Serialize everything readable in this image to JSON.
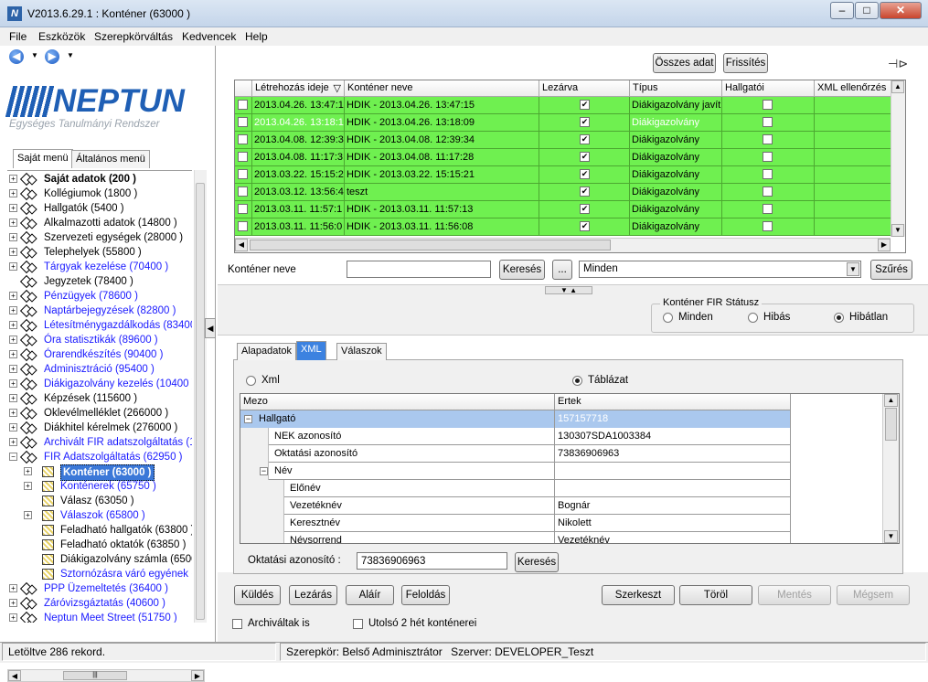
{
  "window": {
    "title": "V2013.6.29.1 : Konténer (63000  )",
    "icon": "N",
    "min": "‒",
    "max": "□",
    "close": "✕"
  },
  "menu": [
    "File",
    "Eszközök",
    "Szerepkörváltás",
    "Kedvencek",
    "Help"
  ],
  "logo": {
    "word": "NEPTUN",
    "sub": "Egységes Tanulmányi Rendszer"
  },
  "left_tabs": {
    "own": "Saját menü",
    "general": "Általános menü"
  },
  "tree": [
    {
      "label": "Saját adatok (200  )",
      "style": "bold",
      "depth": 0,
      "icon": "diamond",
      "exp": "+"
    },
    {
      "label": "Kollégiumok (1800  )",
      "style": "",
      "depth": 0,
      "icon": "diamond",
      "exp": "+"
    },
    {
      "label": "Hallgatók (5400  )",
      "style": "",
      "depth": 0,
      "icon": "diamond",
      "exp": "+"
    },
    {
      "label": "Alkalmazotti adatok (14800  )",
      "style": "",
      "depth": 0,
      "icon": "diamond",
      "exp": "+"
    },
    {
      "label": "Szervezeti egységek (28000  )",
      "style": "",
      "depth": 0,
      "icon": "diamond",
      "exp": "+"
    },
    {
      "label": "Telephelyek (55800  )",
      "style": "",
      "depth": 0,
      "icon": "diamond",
      "exp": "+"
    },
    {
      "label": "Tárgyak kezelése (70400  )",
      "style": "blue",
      "depth": 0,
      "icon": "diamond",
      "exp": "+"
    },
    {
      "label": "Jegyzetek (78400  )",
      "style": "",
      "depth": 0,
      "icon": "diamond",
      "exp": ""
    },
    {
      "label": "Pénzügyek (78600  )",
      "style": "blue",
      "depth": 0,
      "icon": "diamond",
      "exp": "+"
    },
    {
      "label": "Naptárbejegyzések (82800  )",
      "style": "blue",
      "depth": 0,
      "icon": "diamond",
      "exp": "+"
    },
    {
      "label": "Létesítménygazdálkodás (83400",
      "style": "blue",
      "depth": 0,
      "icon": "diamond",
      "exp": "+"
    },
    {
      "label": "Óra statisztikák (89600  )",
      "style": "blue",
      "depth": 0,
      "icon": "diamond",
      "exp": "+"
    },
    {
      "label": "Órarendkészítés (90400  )",
      "style": "blue",
      "depth": 0,
      "icon": "diamond",
      "exp": "+"
    },
    {
      "label": "Adminisztráció (95400  )",
      "style": "blue",
      "depth": 0,
      "icon": "diamond",
      "exp": "+"
    },
    {
      "label": "Diákigazolvány kezelés (10400  )",
      "style": "blue",
      "depth": 0,
      "icon": "diamond",
      "exp": "+"
    },
    {
      "label": "Képzések (115600  )",
      "style": "",
      "depth": 0,
      "icon": "diamond",
      "exp": "+"
    },
    {
      "label": "Oklevélmelléklet (266000  )",
      "style": "",
      "depth": 0,
      "icon": "diamond",
      "exp": "+"
    },
    {
      "label": "Diákhitel kérelmek (276000  )",
      "style": "",
      "depth": 0,
      "icon": "diamond",
      "exp": "+"
    },
    {
      "label": "Archivált FIR adatszolgáltatás (14",
      "style": "blue",
      "depth": 0,
      "icon": "diamond",
      "exp": "+"
    },
    {
      "label": "FIR Adatszolgáltatás (62950  )",
      "style": "blue",
      "depth": 0,
      "icon": "diamond",
      "exp": "−"
    },
    {
      "label": "Konténer (63000  )",
      "style": "sel",
      "depth": 1,
      "icon": "folder",
      "exp": "+"
    },
    {
      "label": "Konténerek (65750  )",
      "style": "blue",
      "depth": 1,
      "icon": "folder",
      "exp": "+"
    },
    {
      "label": "Válasz (63050  )",
      "style": "",
      "depth": 1,
      "icon": "folder",
      "exp": ""
    },
    {
      "label": "Válaszok (65800  )",
      "style": "blue",
      "depth": 1,
      "icon": "folder",
      "exp": "+"
    },
    {
      "label": "Feladható hallgatók (63800  )",
      "style": "",
      "depth": 1,
      "icon": "folder",
      "exp": ""
    },
    {
      "label": "Feladható oktatók (63850  )",
      "style": "",
      "depth": 1,
      "icon": "folder",
      "exp": ""
    },
    {
      "label": "Diákigazolvány számla (65000",
      "style": "",
      "depth": 1,
      "icon": "folder",
      "exp": ""
    },
    {
      "label": "Sztornózásra váró egyének (7",
      "style": "blue",
      "depth": 1,
      "icon": "folder",
      "exp": ""
    },
    {
      "label": "PPP Üzemeltetés (36400  )",
      "style": "blue",
      "depth": 0,
      "icon": "diamond",
      "exp": "+"
    },
    {
      "label": "Záróvizsgáztatás (40600  )",
      "style": "blue",
      "depth": 0,
      "icon": "diamond",
      "exp": "+"
    },
    {
      "label": "Neptun Meet Street (51750  )",
      "style": "blue",
      "depth": 0,
      "icon": "diamond",
      "exp": "+"
    }
  ],
  "top_buttons": {
    "all": "Összes adat",
    "refresh": "Frissítés"
  },
  "grid": {
    "headers": [
      "Létrehozás ideje",
      "Konténer neve",
      "Lezárva",
      "Típus",
      "Hallgatói",
      "XML ellenőrzés"
    ],
    "sort_icon": "▽",
    "rows": [
      {
        "date": "2013.04.26. 13:47:1",
        "name": "HDIK - 2013.04.26. 13:47:15",
        "closed": true,
        "type": "Diákigazolvány javít",
        "student": false,
        "hl": false
      },
      {
        "date": "2013.04.26. 13:18:1",
        "name": "HDIK - 2013.04.26. 13:18:09",
        "closed": true,
        "type": "Diákigazolvány",
        "student": false,
        "hl": true
      },
      {
        "date": "2013.04.08. 12:39:3",
        "name": "HDIK - 2013.04.08. 12:39:34",
        "closed": true,
        "type": "Diákigazolvány",
        "student": false,
        "hl": false
      },
      {
        "date": "2013.04.08. 11:17:3",
        "name": "HDIK - 2013.04.08. 11:17:28",
        "closed": true,
        "type": "Diákigazolvány",
        "student": false,
        "hl": false
      },
      {
        "date": "2013.03.22. 15:15:2",
        "name": "HDIK - 2013.03.22. 15:15:21",
        "closed": true,
        "type": "Diákigazolvány",
        "student": false,
        "hl": false
      },
      {
        "date": "2013.03.12. 13:56:4",
        "name": "teszt",
        "closed": true,
        "type": "Diákigazolvány",
        "student": false,
        "hl": false
      },
      {
        "date": "2013.03.11. 11:57:1",
        "name": "HDIK - 2013.03.11. 11:57:13",
        "closed": true,
        "type": "Diákigazolvány",
        "student": false,
        "hl": false
      },
      {
        "date": "2013.03.11. 11:56:0",
        "name": "HDIK - 2013.03.11. 11:56:08",
        "closed": true,
        "type": "Diákigazolvány",
        "student": false,
        "hl": false
      }
    ],
    "row_color": "#6ff050"
  },
  "search": {
    "label": "Konténer neve",
    "value": "",
    "button": "Keresés",
    "dots": "...",
    "filter": "Minden",
    "filter_button": "Szűrés"
  },
  "fir": {
    "title": "Konténer FIR Státusz",
    "options": [
      "Minden",
      "Hibás",
      "Hibátlan"
    ],
    "selected": 2
  },
  "detail_tabs": [
    "Alapadatok",
    "XML",
    "Válaszok"
  ],
  "xml_view": {
    "opt_xml": "Xml",
    "opt_table": "Táblázat"
  },
  "xmltable": {
    "headers": [
      "Mezo",
      "Ertek"
    ],
    "rows": [
      {
        "key": "Hallgató",
        "val": "157157718",
        "depth": 0,
        "exp": "−",
        "sel": true
      },
      {
        "key": "NEK azonosító",
        "val": "130307SDA1003384",
        "depth": 1,
        "exp": "",
        "sel": false
      },
      {
        "key": "Oktatási azonosító",
        "val": "73836906963",
        "depth": 1,
        "exp": "",
        "sel": false
      },
      {
        "key": "Név",
        "val": "",
        "depth": 1,
        "exp": "−",
        "sel": false
      },
      {
        "key": "Előnév",
        "val": "",
        "depth": 2,
        "exp": "",
        "sel": false
      },
      {
        "key": "Vezetéknév",
        "val": "Bognár",
        "depth": 2,
        "exp": "",
        "sel": false
      },
      {
        "key": "Keresztnév",
        "val": "Nikolett",
        "depth": 2,
        "exp": "",
        "sel": false
      },
      {
        "key": "Névsorrend",
        "val": "Vezetéknév",
        "depth": 2,
        "exp": "",
        "sel": false
      }
    ]
  },
  "oktatasi": {
    "label": "Oktatási azonosító :",
    "value": "73836906963",
    "button": "Keresés"
  },
  "bottom_buttons": {
    "send": "Küldés",
    "close": "Lezárás",
    "sign": "Aláír",
    "release": "Feloldás",
    "edit": "Szerkeszt",
    "delete": "Töröl",
    "save": "Mentés",
    "cancel": "Mégsem"
  },
  "checks": {
    "archived": "Archiváltak is",
    "last2": "Utolsó 2 hét konténerei"
  },
  "status": {
    "records": "Letöltve 286 rekord.",
    "role": "Szerepkör: Belső Adminisztrátor",
    "server": "Szerver: DEVELOPER_Teszt"
  }
}
